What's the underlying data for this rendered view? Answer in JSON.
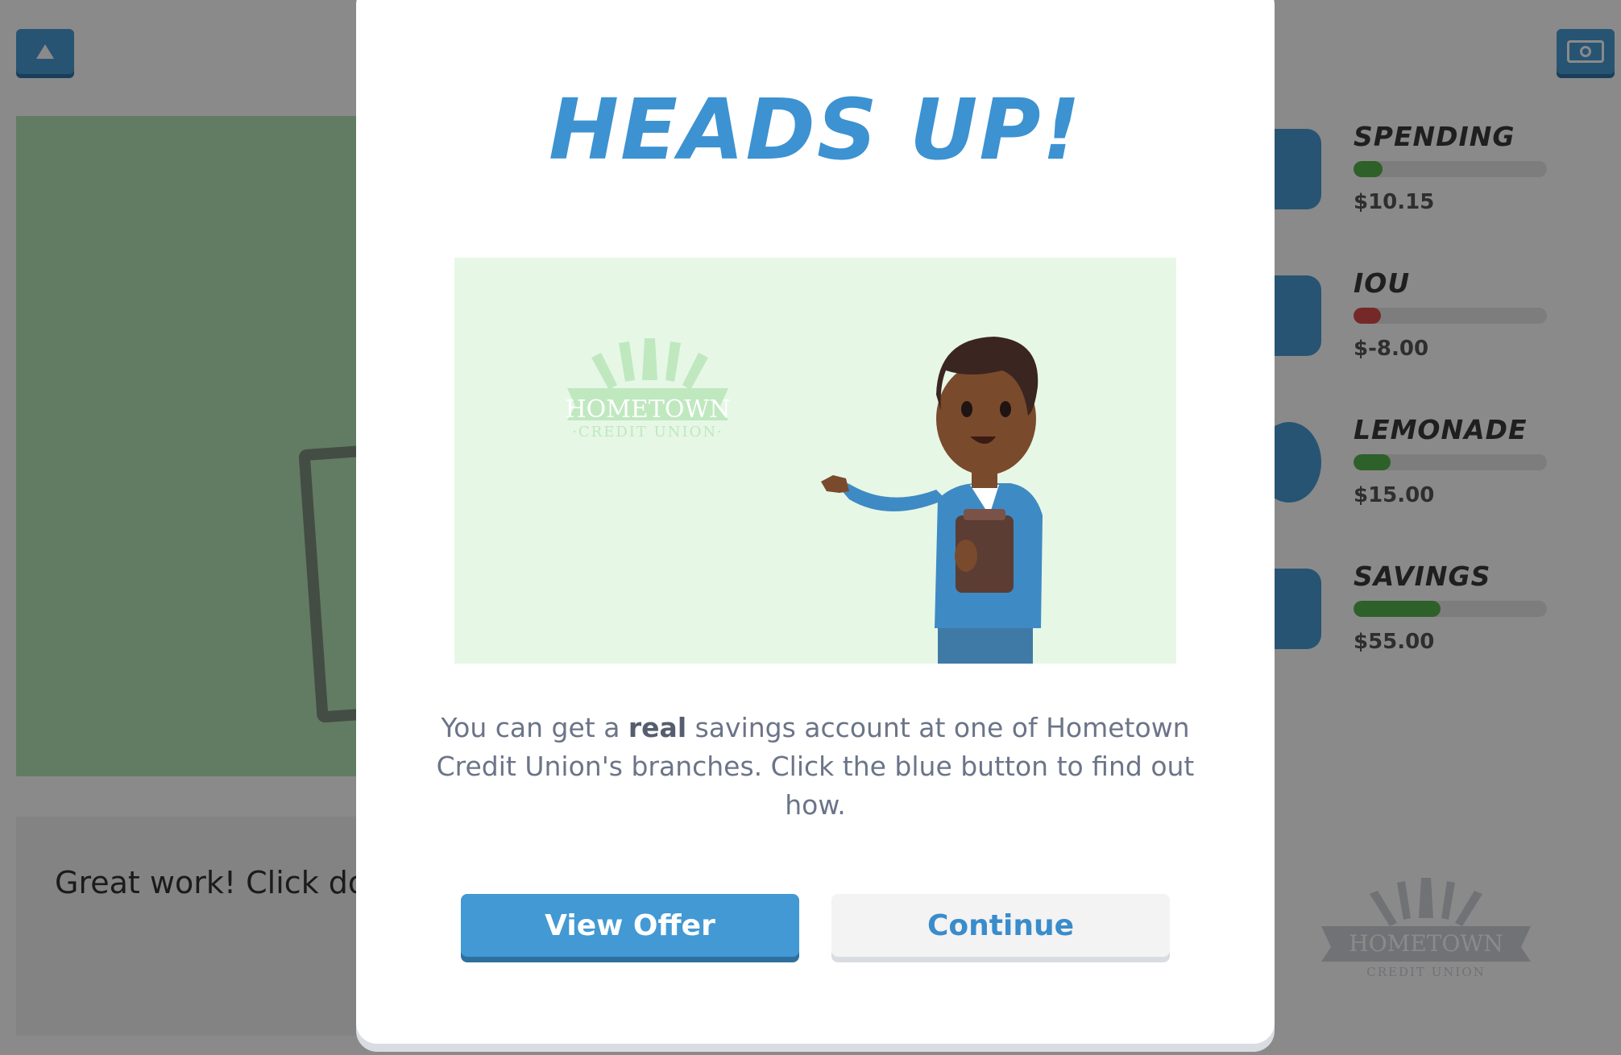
{
  "background": {
    "message": "Great work! Click done",
    "accounts": [
      {
        "name": "SPENDING",
        "amount": "$10.15",
        "fill": 0.15,
        "color": "#56b24c"
      },
      {
        "name": "IOU",
        "amount": "$-8.00",
        "fill": 0.14,
        "color": "#d94b4b"
      },
      {
        "name": "LEMONADE",
        "amount": "$15.00",
        "fill": 0.19,
        "color": "#56b24c"
      },
      {
        "name": "SAVINGS",
        "amount": "$55.00",
        "fill": 0.45,
        "color": "#56b24c"
      }
    ],
    "logo": {
      "line1": "HOMETOWN",
      "line2": "CREDIT UNION"
    }
  },
  "modal": {
    "title": "HEADS UP!",
    "logo": {
      "line1": "HOMETOWN",
      "line2": "·CREDIT UNION·"
    },
    "body_prefix": "You can get a ",
    "body_bold": "real",
    "body_suffix": " savings account at one of Hometown Credit Union's branches. Click the blue button to find out how.",
    "view_offer_label": "View Offer",
    "continue_label": "Continue"
  },
  "colors": {
    "accent": "#3d92d1",
    "button_primary": "#4399d3",
    "illustration_bg": "#e6f7e6"
  },
  "icons": [
    "up-arrow-icon",
    "cash-icon",
    "jar-icon",
    "receipt-icon",
    "lemon-icon",
    "safe-icon"
  ]
}
